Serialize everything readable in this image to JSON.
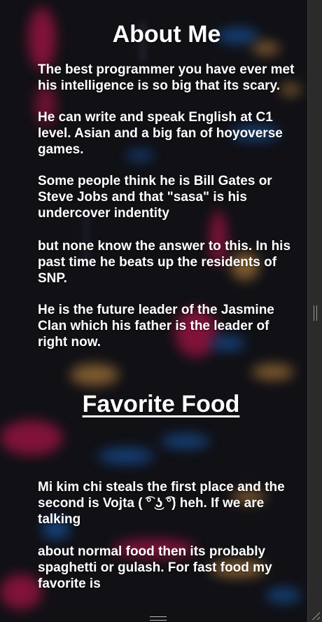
{
  "about": {
    "title": "About Me",
    "paragraphs": [
      "The best programmer you have ever met his intelligence is so big that its scary.",
      "He can write and speak English at C1 level. Asian and a big fan of hoyoverse games.",
      "Some people think he is Bill Gates or Steve Jobs and that \"sasa\" is his undercover indentity",
      "but none know the answer to this. In his past time he beats up the residents of SNP.",
      "He is the future leader of the Jasmine Clan which his father is the leader of right now."
    ]
  },
  "food": {
    "title": "Favorite Food",
    "paragraphs": [
      "Mi kim chi steals the first place and the second is Vojta ( ͡° ͜ʖ ͡°) heh. If we are talking",
      "about normal food then its probably spaghetti or gulash. For fast food my favorite is"
    ]
  },
  "background": {
    "colors": [
      "#e0195a",
      "#1f6fd1",
      "#e2a04a",
      "#141419"
    ]
  }
}
